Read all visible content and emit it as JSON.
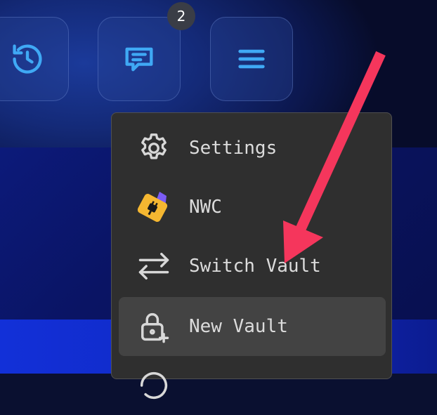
{
  "toolbar": {
    "notification_count": "2",
    "buttons": [
      {
        "icon": "history-icon"
      },
      {
        "icon": "message-icon"
      },
      {
        "icon": "hamburger-menu-icon"
      }
    ],
    "icon_color": "#3fa9f5"
  },
  "menu": {
    "items": [
      {
        "label": "Settings",
        "icon": "gear-icon"
      },
      {
        "label": "NWC",
        "icon": "nwc-logo-icon"
      },
      {
        "label": "Switch Vault",
        "icon": "switch-arrows-icon"
      },
      {
        "label": "New Vault",
        "icon": "lock-plus-icon"
      }
    ],
    "highlighted_item": "New Vault"
  },
  "annotation": {
    "color": "#f5365c",
    "icon": "pointer-arrow"
  }
}
